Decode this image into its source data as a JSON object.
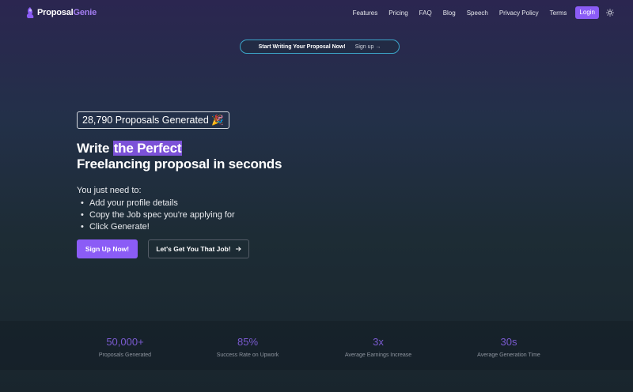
{
  "brand": {
    "name_part1": "Proposal",
    "name_part2": "Genie",
    "accent": "#8b5cf6"
  },
  "nav": {
    "links": [
      "Features",
      "Pricing",
      "FAQ",
      "Blog",
      "Speech",
      "Privacy Policy",
      "Terms"
    ],
    "login_label": "Login",
    "theme_icon": "sun-icon"
  },
  "announcement": {
    "text": "Start Writing Your Proposal Now!",
    "link": "Sign up →"
  },
  "hero": {
    "counter": "28,790 Proposals Generated 🎉",
    "title_prefix": "Write ",
    "title_highlight": "the Perfect",
    "title_line2": "Freelancing proposal in seconds",
    "intro": "You just need to:",
    "steps": [
      "Add your profile details",
      "Copy the Job spec you're applying for",
      "Click Generate!"
    ],
    "primary_cta": "Sign Up Now!",
    "secondary_cta": "Let's Get You That Job!",
    "secondary_icon": "arrow-right-icon"
  },
  "stats": [
    {
      "value": "50,000+",
      "label": "Proposals Generated"
    },
    {
      "value": "85%",
      "label": "Success Rate on Upwork"
    },
    {
      "value": "3x",
      "label": "Average Earnings Increase"
    },
    {
      "value": "30s",
      "label": "Average Generation Time"
    }
  ]
}
